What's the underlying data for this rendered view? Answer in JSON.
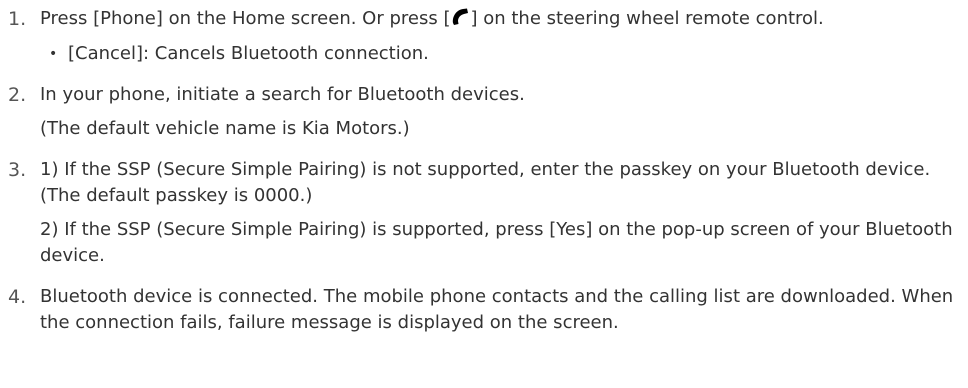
{
  "steps": [
    {
      "number": "1.",
      "text_before_icon": "Press [Phone] on the Home screen. Or press [",
      "icon": "phone-handset-icon",
      "text_after_icon": "] on the steering wheel remote control.",
      "bullet": "[Cancel]: Cancels Bluetooth connection."
    },
    {
      "number": "2.",
      "line1": "In your phone, initiate a search for Bluetooth devices.",
      "line2": "(The default vehicle name is Kia Motors.)"
    },
    {
      "number": "3.",
      "part1": "1) If the SSP (Secure Simple Pairing) is not supported, enter the passkey on your Bluetooth device. (The default passkey is 0000.)",
      "part2": "2) If the SSP (Secure Simple Pairing) is supported, press [Yes] on the pop-up screen of your Bluetooth device."
    },
    {
      "number": "4.",
      "text": "Bluetooth device is connected. The mobile phone contacts and the calling list are downloaded. When the connection fails, failure message is displayed on the screen."
    }
  ],
  "colors": {
    "text": "#333333",
    "number": "#555555",
    "icon": "#000000"
  }
}
